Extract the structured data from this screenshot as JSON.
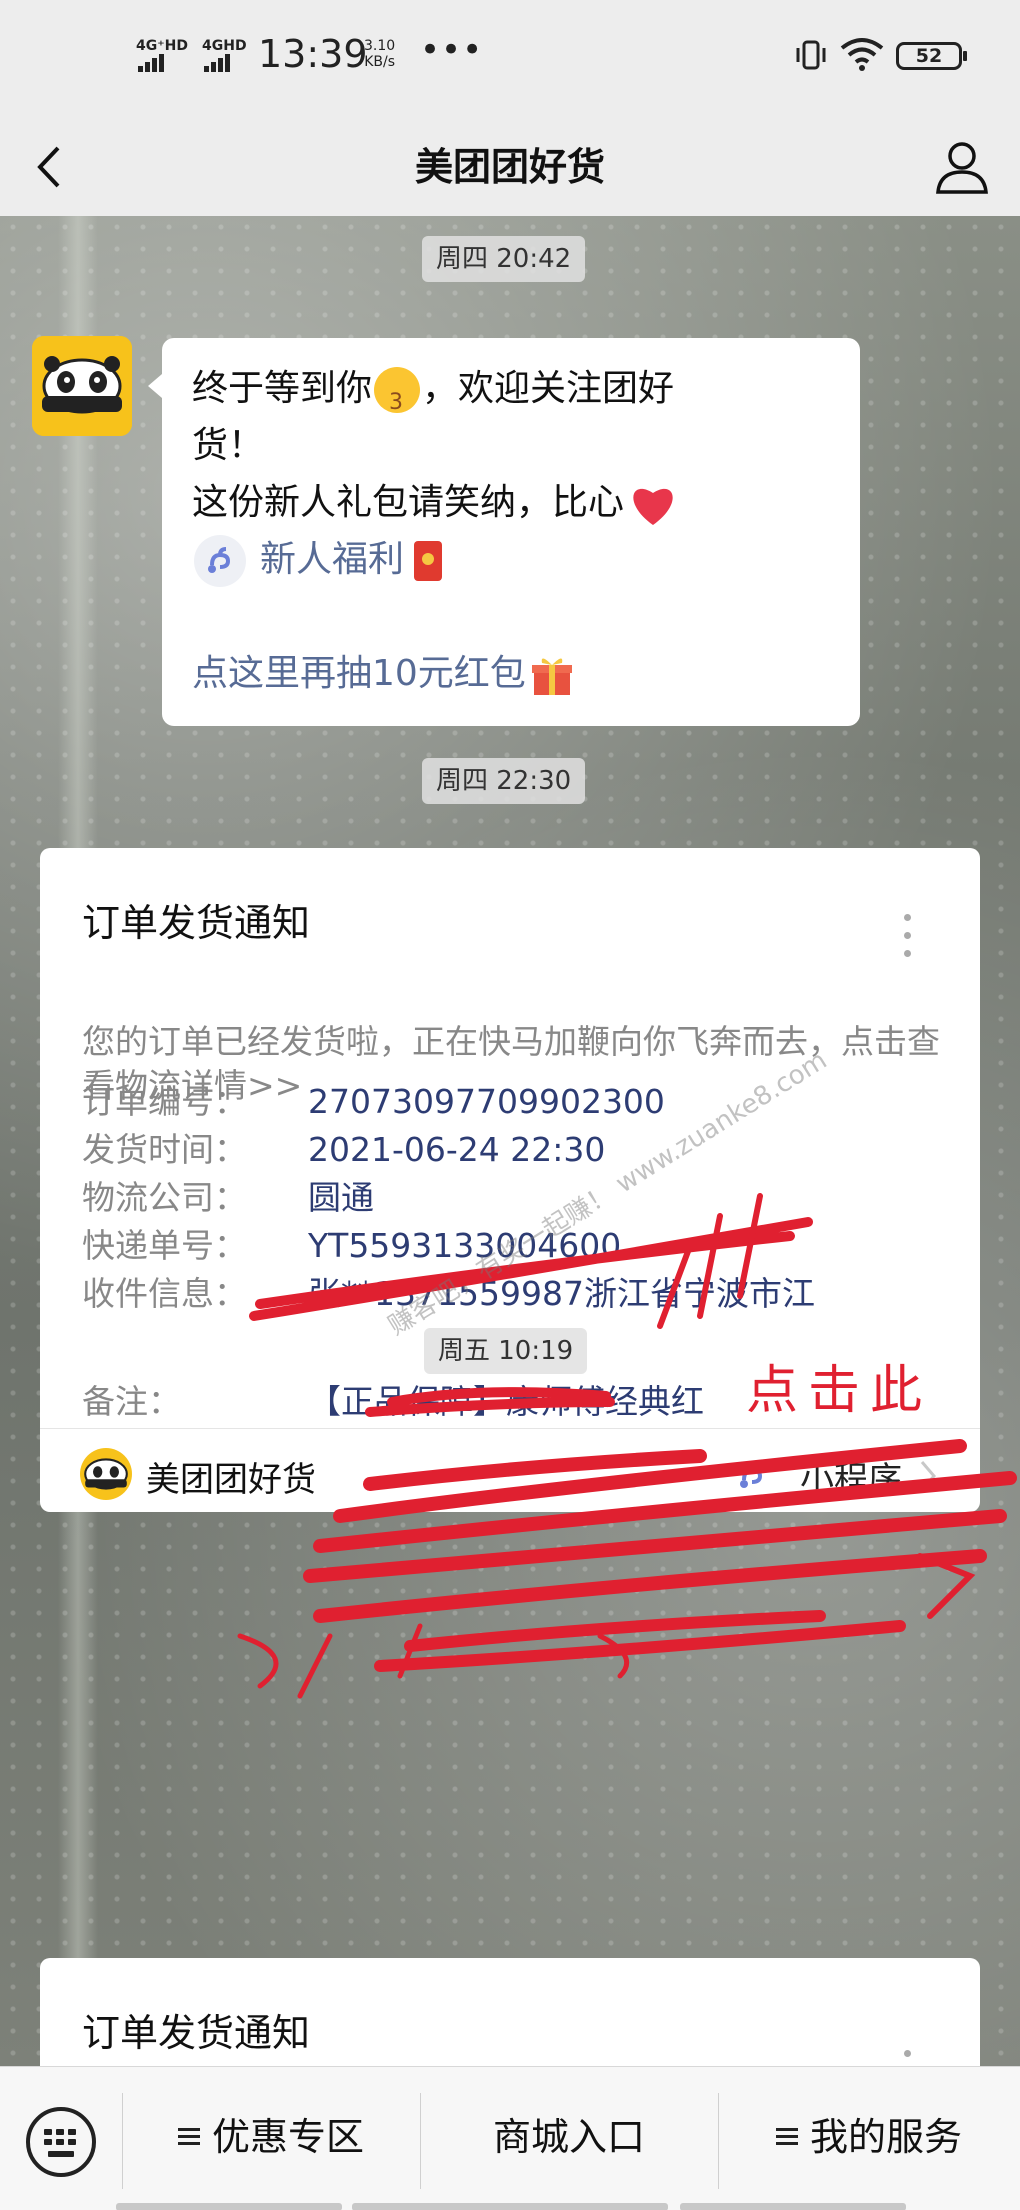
{
  "status_bar": {
    "signal_1": "4G⁺HD",
    "signal_2": "4GHD",
    "time": "13:39",
    "speed_value": "3.10",
    "speed_unit": "KB/s",
    "more": "•••",
    "battery": "52"
  },
  "nav": {
    "title": "美团团好货"
  },
  "chat": {
    "timestamps": [
      "周四 20:42",
      "周四 22:30",
      "周五 10:19"
    ],
    "welcome": {
      "line1": "终于等到你",
      "line1_after": "，欢迎关注团好",
      "line2": "货！",
      "line3": "这份新人礼包请笑纳，比心",
      "mini_link": "新人福利",
      "line5": "点这里再抽10元红包"
    },
    "order_cards": [
      {
        "title": "订单发货通知",
        "description": "您的订单已经发货啦，正在快马加鞭向你飞奔而去，点击查看物流详情>>",
        "fields": [
          {
            "label": "订单编号：",
            "value": "27073097709902300"
          },
          {
            "label": "发货时间：",
            "value": "2021-06-24 22:30"
          },
          {
            "label": "物流公司：",
            "value": "圆通"
          },
          {
            "label": "快递单号：",
            "value": "YT5593133004600"
          },
          {
            "label": "收件信息：",
            "value": "张**1371559987浙江省宁波市江"
          },
          {
            "label": "备注：",
            "value": "【正品保障】康师傅经典红"
          }
        ],
        "footer_name": "美团团好货",
        "footer_mini": "小程序"
      },
      {
        "title": "订单发货通知"
      }
    ],
    "watermark": "赚客吧，有奖一起赚！ www.zuanke8.com",
    "scribble_text": "点击此"
  },
  "bottom_menu": {
    "items": [
      "优惠专区",
      "商城入口",
      "我的服务"
    ]
  }
}
